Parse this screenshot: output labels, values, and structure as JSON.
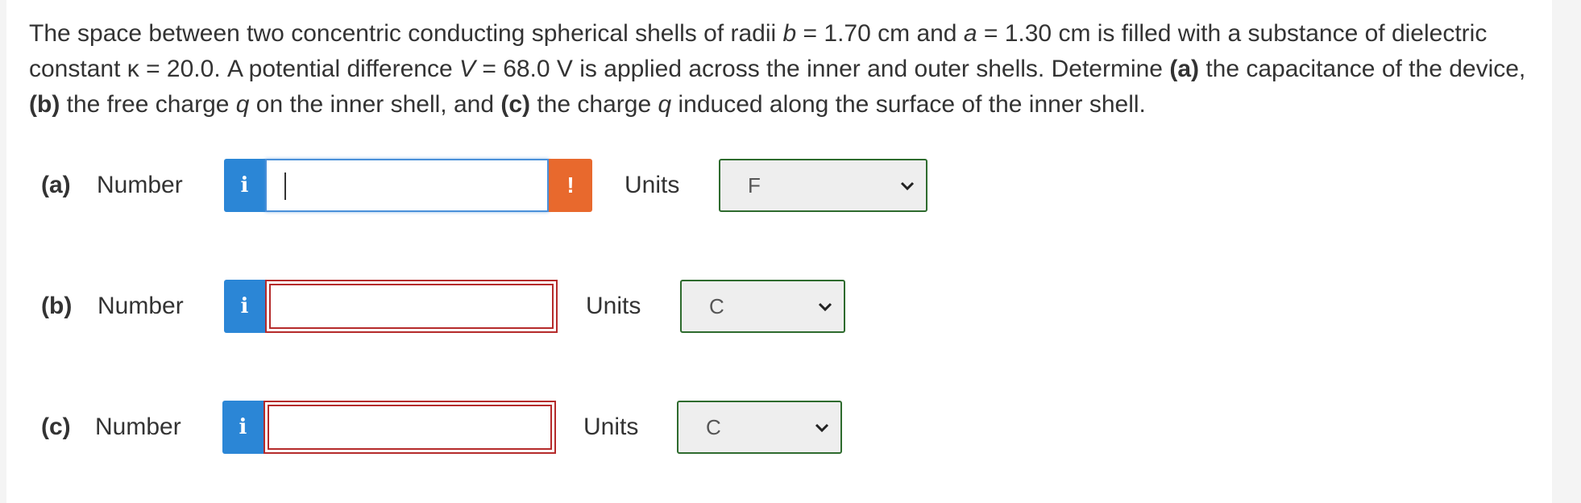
{
  "question": {
    "s1": "The space between two concentric conducting spherical shells of radii ",
    "b_var": "b",
    "s2": " = 1.70 cm and ",
    "a_var": "a",
    "s3": " = 1.30 cm is filled with a substance of dielectric constant κ = 20.0. A potential difference ",
    "v_var": "V",
    "s4": " = 68.0 V is applied across the inner and outer shells. Determine ",
    "pa": "(a)",
    "s5": " the capacitance of the device, ",
    "pb": "(b)",
    "s6": " the free charge ",
    "q1": "q",
    "s7": " on the inner shell, and ",
    "pc": "(c)",
    "s8": " the charge ",
    "q2": "q",
    "s9": " induced along the surface of the inner shell."
  },
  "parts": [
    {
      "label": "(a)",
      "field_label": "Number",
      "info": "i",
      "value": "",
      "warning": "!",
      "units_label": "Units",
      "unit": "F"
    },
    {
      "label": "(b)",
      "field_label": "Number",
      "info": "i",
      "value": "",
      "units_label": "Units",
      "unit": "C"
    },
    {
      "label": "(c)",
      "field_label": "Number",
      "info": "i",
      "value": "",
      "units_label": "Units",
      "unit": "C"
    }
  ],
  "colors": {
    "info": "#2b86d6",
    "warning": "#e8692d",
    "invalid_border": "#b52b2b",
    "select_border": "#2e6b2e"
  }
}
